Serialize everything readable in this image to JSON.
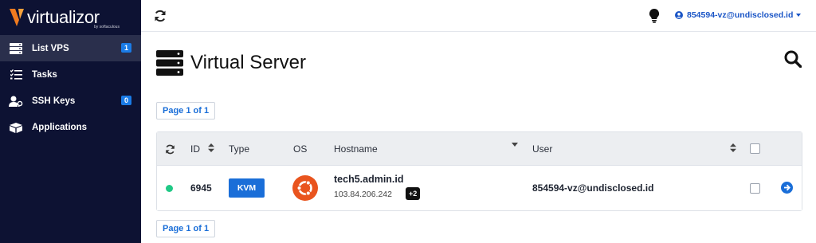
{
  "brand": {
    "name": "virtualizor",
    "tagline": "by softaculous",
    "accent": "#f07b1f"
  },
  "sidebar": {
    "items": [
      {
        "label": "List VPS",
        "badge": "1",
        "icon": "server-list-icon",
        "active": true
      },
      {
        "label": "Tasks",
        "icon": "task-list-icon"
      },
      {
        "label": "SSH Keys",
        "badge": "0",
        "icon": "user-key-icon"
      },
      {
        "label": "Applications",
        "icon": "boxes-icon"
      }
    ]
  },
  "topbar": {
    "user": "854594-vz@undisclosed.id",
    "icons": [
      "refresh-icon",
      "lightbulb-icon",
      "user-circle-icon"
    ]
  },
  "page": {
    "title": "Virtual Server",
    "pager_top": "Page 1 of 1",
    "pager_bottom": "Page 1 of 1"
  },
  "table": {
    "columns": {
      "id": "ID",
      "type": "Type",
      "os": "OS",
      "hostname": "Hostname",
      "user": "User"
    },
    "rows": [
      {
        "status": "online",
        "id": "6945",
        "type": "KVM",
        "os": "ubuntu",
        "hostname": "tech5.admin.id",
        "ip": "103.84.206.242",
        "extra_ips": "+2",
        "user": "854594-vz@undisclosed.id",
        "checked": false
      }
    ]
  },
  "colors": {
    "sidebar_bg": "#0d1233",
    "primary": "#1a6ed8",
    "online": "#20c986",
    "ubuntu": "#e9541e"
  }
}
